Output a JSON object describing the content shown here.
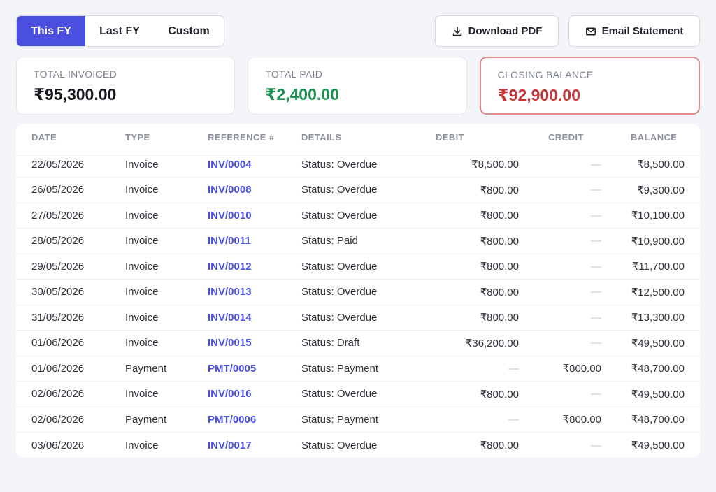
{
  "period_tabs": [
    {
      "label": "This FY",
      "active": true
    },
    {
      "label": "Last FY",
      "active": false
    },
    {
      "label": "Custom",
      "active": false
    }
  ],
  "actions": {
    "download_pdf": "Download PDF",
    "email_statement": "Email Statement"
  },
  "summary": {
    "total_invoiced_label": "TOTAL INVOICED",
    "total_invoiced_value": "₹95,300.00",
    "total_paid_label": "TOTAL PAID",
    "total_paid_value": "₹2,400.00",
    "closing_balance_label": "CLOSING BALANCE",
    "closing_balance_value": "₹92,900.00"
  },
  "colors": {
    "accent": "#4a4fe0",
    "paid": "#1f8f54",
    "closing": "#c0383b"
  },
  "table": {
    "headers": [
      "DATE",
      "TYPE",
      "REFERENCE #",
      "DETAILS",
      "DEBIT",
      "CREDIT",
      "BALANCE"
    ],
    "rows": [
      {
        "date": "22/05/2026",
        "type": "Invoice",
        "ref": "INV/0004",
        "details": "Status: Overdue",
        "debit": "₹8,500.00",
        "credit": "—",
        "balance": "₹8,500.00"
      },
      {
        "date": "26/05/2026",
        "type": "Invoice",
        "ref": "INV/0008",
        "details": "Status: Overdue",
        "debit": "₹800.00",
        "credit": "—",
        "balance": "₹9,300.00"
      },
      {
        "date": "27/05/2026",
        "type": "Invoice",
        "ref": "INV/0010",
        "details": "Status: Overdue",
        "debit": "₹800.00",
        "credit": "—",
        "balance": "₹10,100.00"
      },
      {
        "date": "28/05/2026",
        "type": "Invoice",
        "ref": "INV/0011",
        "details": "Status: Paid",
        "debit": "₹800.00",
        "credit": "—",
        "balance": "₹10,900.00"
      },
      {
        "date": "29/05/2026",
        "type": "Invoice",
        "ref": "INV/0012",
        "details": "Status: Overdue",
        "debit": "₹800.00",
        "credit": "—",
        "balance": "₹11,700.00"
      },
      {
        "date": "30/05/2026",
        "type": "Invoice",
        "ref": "INV/0013",
        "details": "Status: Overdue",
        "debit": "₹800.00",
        "credit": "—",
        "balance": "₹12,500.00"
      },
      {
        "date": "31/05/2026",
        "type": "Invoice",
        "ref": "INV/0014",
        "details": "Status: Overdue",
        "debit": "₹800.00",
        "credit": "—",
        "balance": "₹13,300.00"
      },
      {
        "date": "01/06/2026",
        "type": "Invoice",
        "ref": "INV/0015",
        "details": "Status: Draft",
        "debit": "₹36,200.00",
        "credit": "—",
        "balance": "₹49,500.00"
      },
      {
        "date": "01/06/2026",
        "type": "Payment",
        "ref": "PMT/0005",
        "details": "Status: Payment",
        "debit": "—",
        "credit": "₹800.00",
        "balance": "₹48,700.00"
      },
      {
        "date": "02/06/2026",
        "type": "Invoice",
        "ref": "INV/0016",
        "details": "Status: Overdue",
        "debit": "₹800.00",
        "credit": "—",
        "balance": "₹49,500.00"
      },
      {
        "date": "02/06/2026",
        "type": "Payment",
        "ref": "PMT/0006",
        "details": "Status: Payment",
        "debit": "—",
        "credit": "₹800.00",
        "balance": "₹48,700.00"
      },
      {
        "date": "03/06/2026",
        "type": "Invoice",
        "ref": "INV/0017",
        "details": "Status: Overdue",
        "debit": "₹800.00",
        "credit": "—",
        "balance": "₹49,500.00"
      }
    ]
  }
}
